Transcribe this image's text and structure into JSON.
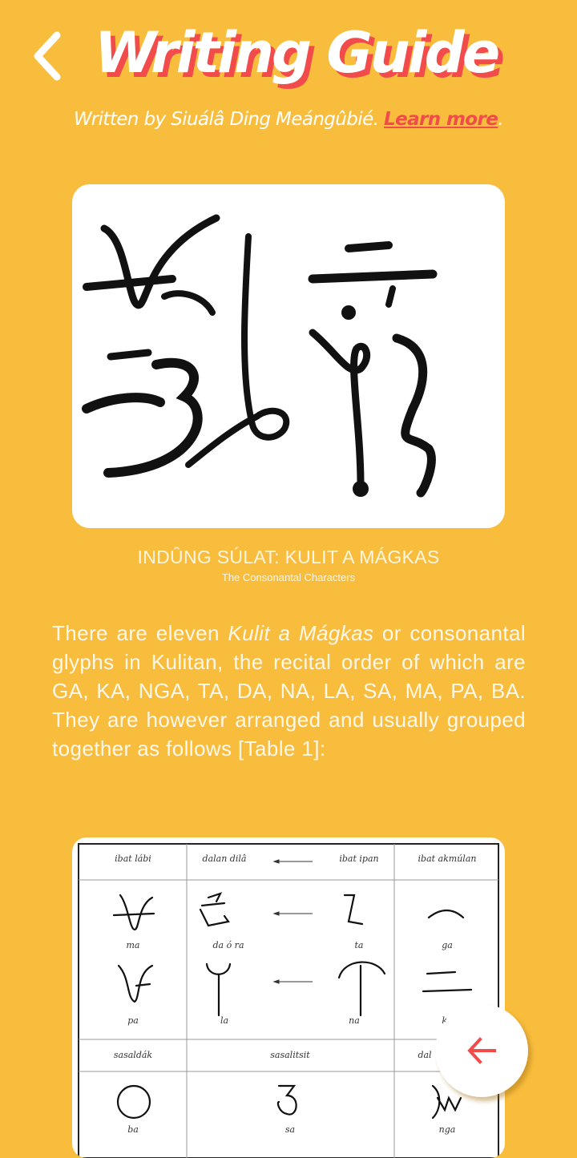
{
  "header": {
    "back_icon": "chevron-left-icon",
    "title": "Writing Guide",
    "byline_prefix": "Written by Siuálâ Ding Meángûbié. ",
    "learn_more_label": "Learn more",
    "byline_suffix": "."
  },
  "hero": {
    "image_description": "Kulitan script calligraphy"
  },
  "caption": {
    "title": "INDÛNG SÚLAT: KULIT A MÁGKAS",
    "subtitle": "The Consonantal Characters"
  },
  "paragraph": {
    "part1": "There are eleven ",
    "emphasis": "Kulit a Mágkas",
    "part2": " or consonantal glyphs in Kulitan, the recital order of which are GA, KA, NGA, TA, DA, NA, LA, SA, MA, PA, BA. They are however arranged and usually grouped together as follows [Table 1]:"
  },
  "table": {
    "headers_row1": [
      "ibat lábi",
      "dalan dilâ",
      "ibat ipan",
      "ibat akmúlan"
    ],
    "row1_labels": [
      "ma",
      "da  ó ra",
      "ta",
      "ga"
    ],
    "row2_labels": [
      "pa",
      "la",
      "na",
      "ka"
    ],
    "headers_row2": [
      "sasaldák",
      "sasalitsit",
      "dal"
    ],
    "row3_labels": [
      "ba",
      "sa",
      "nga"
    ]
  },
  "fab": {
    "icon": "arrow-left-icon"
  },
  "colors": {
    "background": "#F9BD3D",
    "accent": "#F24B4B",
    "text": "#FFFFFF"
  }
}
